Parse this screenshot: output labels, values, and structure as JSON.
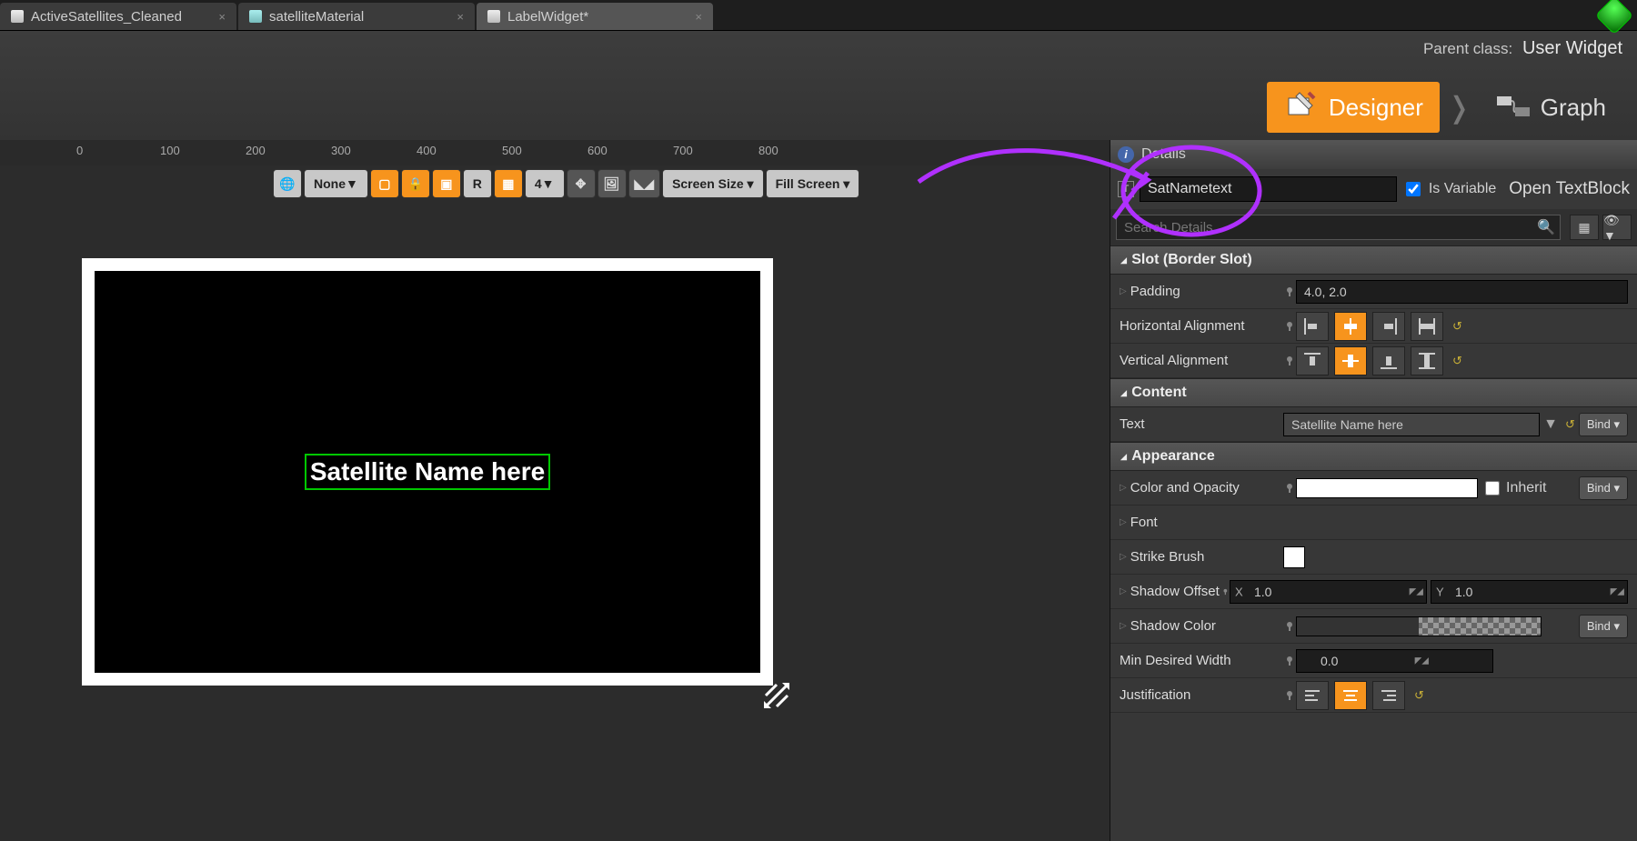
{
  "tabs": [
    {
      "label": "ActiveSatellites_Cleaned",
      "active": false,
      "icon": "w"
    },
    {
      "label": "satelliteMaterial",
      "active": false,
      "icon": "m"
    },
    {
      "label": "LabelWidget*",
      "active": true,
      "icon": "wb"
    }
  ],
  "parent_class_label": "Parent class:",
  "parent_class_value": "User Widget",
  "mode_designer": "Designer",
  "mode_graph": "Graph",
  "ruler_marks": [
    "0",
    "100",
    "200",
    "300",
    "400",
    "500",
    "600",
    "700",
    "800"
  ],
  "viewport_toolbar": {
    "none": "None",
    "grid_value": "4",
    "screen_size": "Screen Size ▾",
    "fill_screen": "Fill Screen ▾",
    "r_letter": "R"
  },
  "canvas_text": "Satellite Name here",
  "details": {
    "title": "Details",
    "widget_name": "SatNametext",
    "is_variable_label": "Is Variable",
    "open_class": "Open TextBlock",
    "search_placeholder": "Search Details",
    "sections": {
      "slot": {
        "title": "Slot (Border Slot)",
        "padding_label": "Padding",
        "padding_value": "4.0, 2.0",
        "halign_label": "Horizontal Alignment",
        "valign_label": "Vertical Alignment"
      },
      "content": {
        "title": "Content",
        "text_label": "Text",
        "text_value": "Satellite Name here",
        "bind": "Bind ▾"
      },
      "appearance": {
        "title": "Appearance",
        "color_label": "Color and Opacity",
        "inherit": "Inherit",
        "font_label": "Font",
        "strike_label": "Strike Brush",
        "shadow_offset_label": "Shadow Offset",
        "shadow_offset_x": "1.0",
        "shadow_offset_y": "1.0",
        "shadow_color_label": "Shadow Color",
        "min_width_label": "Min Desired Width",
        "min_width_value": "0.0",
        "justification_label": "Justification",
        "bind": "Bind ▾"
      }
    }
  }
}
